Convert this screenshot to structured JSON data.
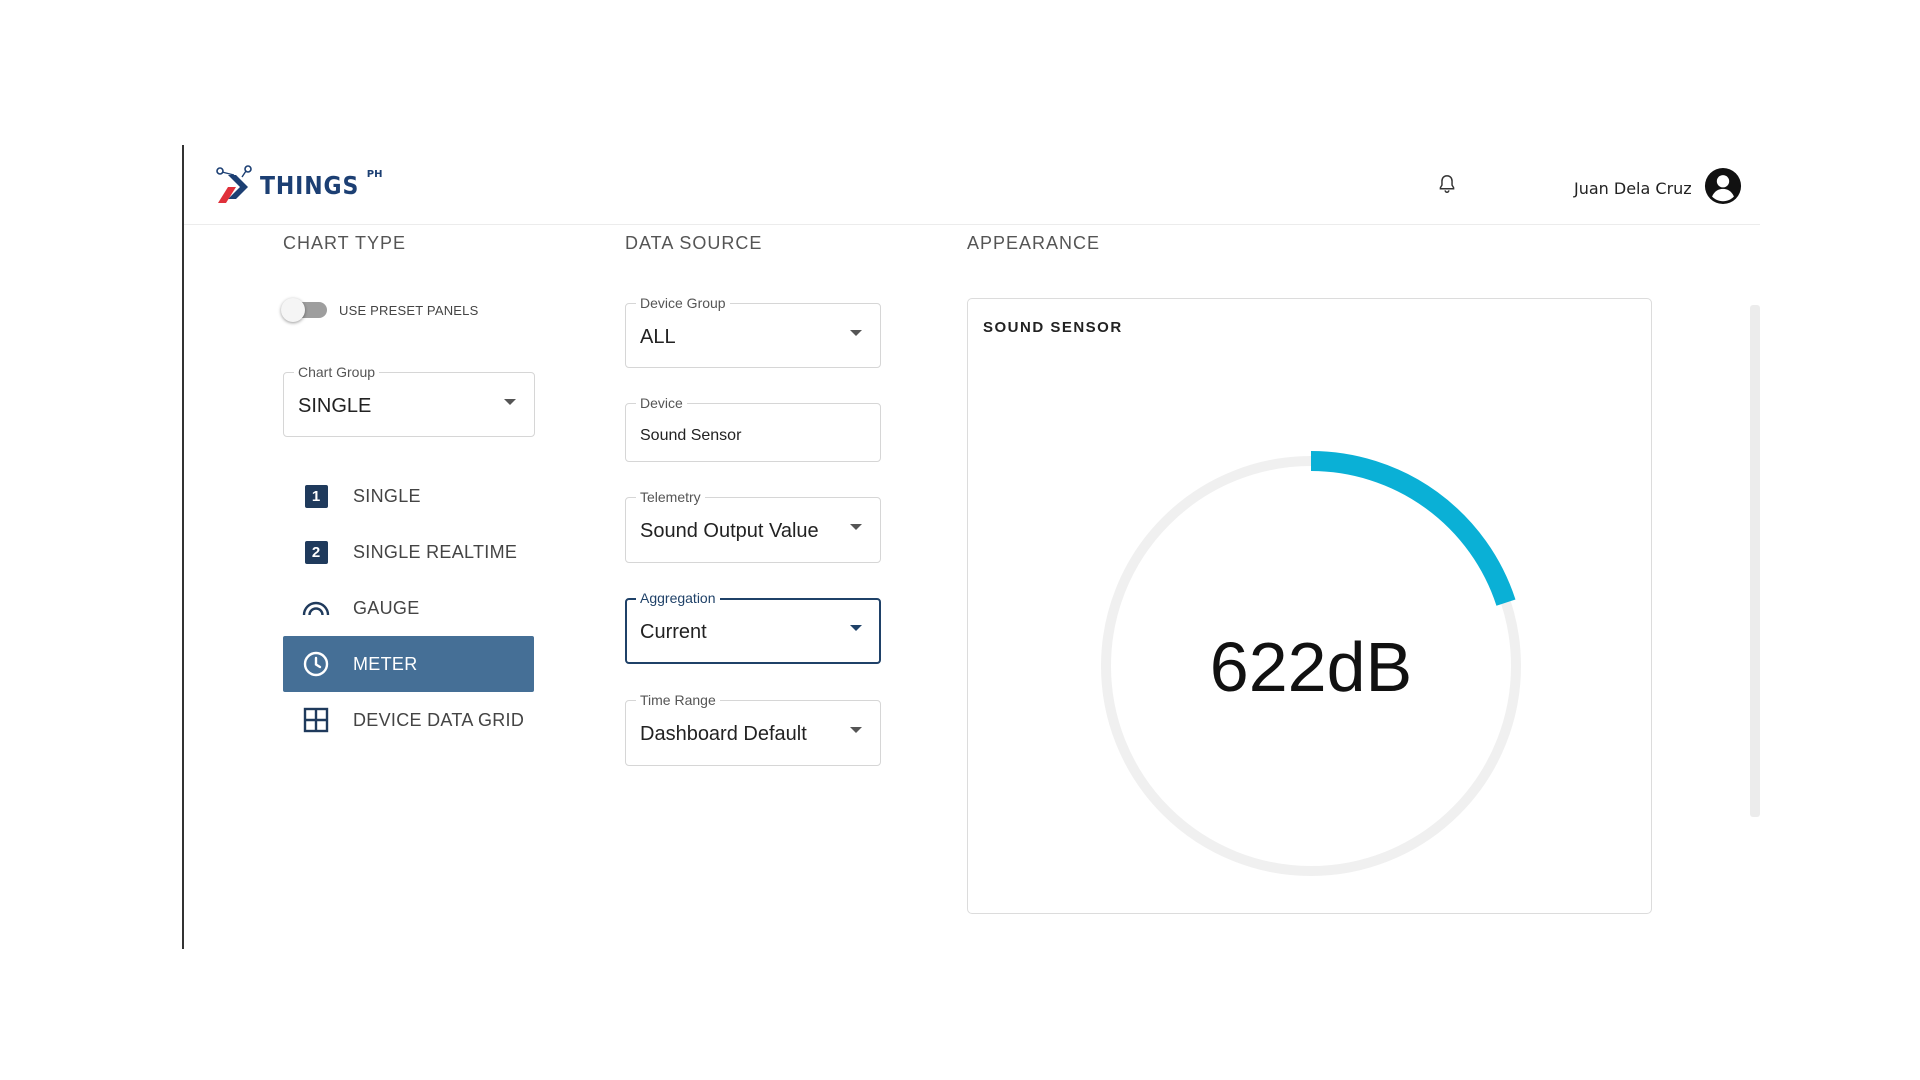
{
  "header": {
    "logo_text": "THINGS",
    "logo_sup": "PH",
    "user_name": "Juan Dela Cruz"
  },
  "sections": {
    "chart_type": "CHART TYPE",
    "data_source": "DATA SOURCE",
    "appearance": "APPEARANCE"
  },
  "chart_type": {
    "preset_toggle_label": "USE PRESET PANELS",
    "preset_toggle_on": false,
    "chart_group": {
      "label": "Chart Group",
      "value": "SINGLE"
    },
    "items": [
      {
        "label": "SINGLE",
        "icon": "number-1-icon",
        "badge": "1",
        "active": false
      },
      {
        "label": "SINGLE REALTIME",
        "icon": "number-2-icon",
        "badge": "2",
        "active": false
      },
      {
        "label": "GAUGE",
        "icon": "gauge-icon",
        "active": false
      },
      {
        "label": "METER",
        "icon": "clock-icon",
        "active": true
      },
      {
        "label": "DEVICE DATA GRID",
        "icon": "grid-icon",
        "active": false
      }
    ]
  },
  "data_source": {
    "device_group": {
      "label": "Device Group",
      "value": "ALL"
    },
    "device": {
      "label": "Device",
      "value": "Sound Sensor"
    },
    "telemetry": {
      "label": "Telemetry",
      "value": "Sound Output Value"
    },
    "aggregation": {
      "label": "Aggregation",
      "value": "Current"
    },
    "time_range": {
      "label": "Time Range",
      "value": "Dashboard Default"
    }
  },
  "appearance": {
    "card_title": "SOUND SENSOR",
    "meter_value": "622dB",
    "meter_fill_fraction": 0.2,
    "accent_color": "#0ab0d6",
    "track_color": "#f0f0f0"
  },
  "colors": {
    "brand_navy": "#1c3f73",
    "active_item_bg": "#456f96",
    "focused_border": "#1f4168",
    "logo_red": "#e0303a"
  }
}
